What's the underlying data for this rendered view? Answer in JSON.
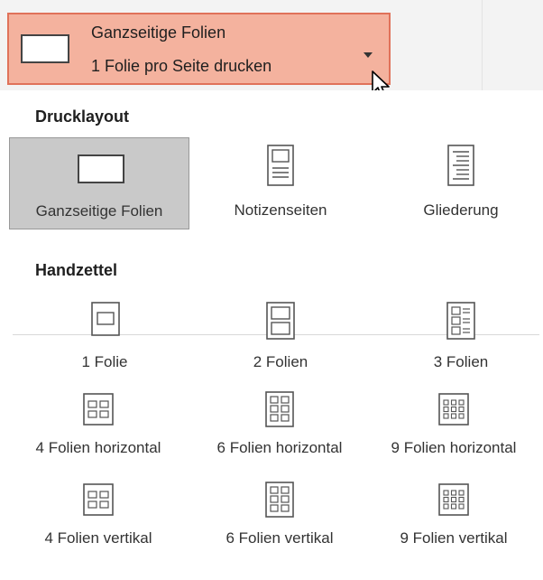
{
  "dropdown": {
    "title": "Ganzseitige Folien",
    "subtitle": "1 Folie pro Seite drucken",
    "accent": "#f4b29e",
    "border": "#e0725a"
  },
  "sections": {
    "layout_heading": "Drucklayout",
    "handouts_heading": "Handzettel"
  },
  "layout_items": [
    {
      "label": "Ganzseitige Folien",
      "icon": "full-page-slide-icon",
      "selected": true
    },
    {
      "label": "Notizenseiten",
      "icon": "notes-page-icon",
      "selected": false
    },
    {
      "label": "Gliederung",
      "icon": "outline-icon",
      "selected": false
    }
  ],
  "handout_items": [
    {
      "label": "1 Folie",
      "icon": "one-slide-icon"
    },
    {
      "label": "2 Folien",
      "icon": "two-slides-icon"
    },
    {
      "label": "3 Folien",
      "icon": "three-slides-icon"
    },
    {
      "label": "4 Folien horizontal",
      "icon": "four-slides-horizontal-icon"
    },
    {
      "label": "6 Folien horizontal",
      "icon": "six-slides-horizontal-icon"
    },
    {
      "label": "9 Folien horizontal",
      "icon": "nine-slides-horizontal-icon"
    },
    {
      "label": "4 Folien vertikal",
      "icon": "four-slides-vertical-icon"
    },
    {
      "label": "6 Folien vertikal",
      "icon": "six-slides-vertical-icon"
    },
    {
      "label": "9 Folien vertikal",
      "icon": "nine-slides-vertical-icon"
    }
  ]
}
